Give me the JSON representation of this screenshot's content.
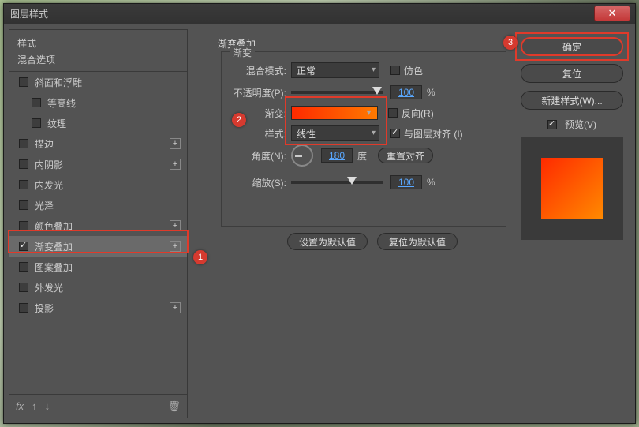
{
  "window": {
    "title": "图层样式"
  },
  "left": {
    "head": "样式",
    "sub": "混合选项",
    "items": [
      {
        "label": "斜面和浮雕",
        "checked": false,
        "plus": false
      },
      {
        "label": "等高线",
        "checked": false,
        "plus": false
      },
      {
        "label": "纹理",
        "checked": false,
        "plus": false
      },
      {
        "label": "描边",
        "checked": false,
        "plus": true
      },
      {
        "label": "内阴影",
        "checked": false,
        "plus": true
      },
      {
        "label": "内发光",
        "checked": false,
        "plus": false
      },
      {
        "label": "光泽",
        "checked": false,
        "plus": false
      },
      {
        "label": "颜色叠加",
        "checked": false,
        "plus": true
      },
      {
        "label": "渐变叠加",
        "checked": true,
        "plus": true,
        "selected": true
      },
      {
        "label": "图案叠加",
        "checked": false,
        "plus": false
      },
      {
        "label": "外发光",
        "checked": false,
        "plus": false
      },
      {
        "label": "投影",
        "checked": false,
        "plus": true
      }
    ],
    "foot": {
      "fx": "fx",
      "up": "↑",
      "down": "↓",
      "trash": "🗑"
    }
  },
  "mid": {
    "section_title": "渐变叠加",
    "group_label": "渐变",
    "blend_label": "混合模式:",
    "blend_value": "正常",
    "dither_label": "仿色",
    "opacity_label": "不透明度(P):",
    "opacity_value": "100",
    "opacity_unit": "%",
    "gradient_label": "渐变:",
    "reverse_label": "反向(R)",
    "style_label": "样式:",
    "style_value": "线性",
    "align_label": "与图层对齐 (I)",
    "angle_label": "角度(N):",
    "angle_value": "180",
    "angle_unit": "度",
    "reset_align": "重置对齐",
    "scale_label": "缩放(S):",
    "scale_value": "100",
    "scale_unit": "%",
    "set_default": "设置为默认值",
    "reset_default": "复位为默认值"
  },
  "right": {
    "ok": "确定",
    "cancel": "复位",
    "new_style": "新建样式(W)...",
    "preview_label": "预览(V)"
  },
  "callouts": {
    "c1": "1",
    "c2": "2",
    "c3": "3"
  }
}
